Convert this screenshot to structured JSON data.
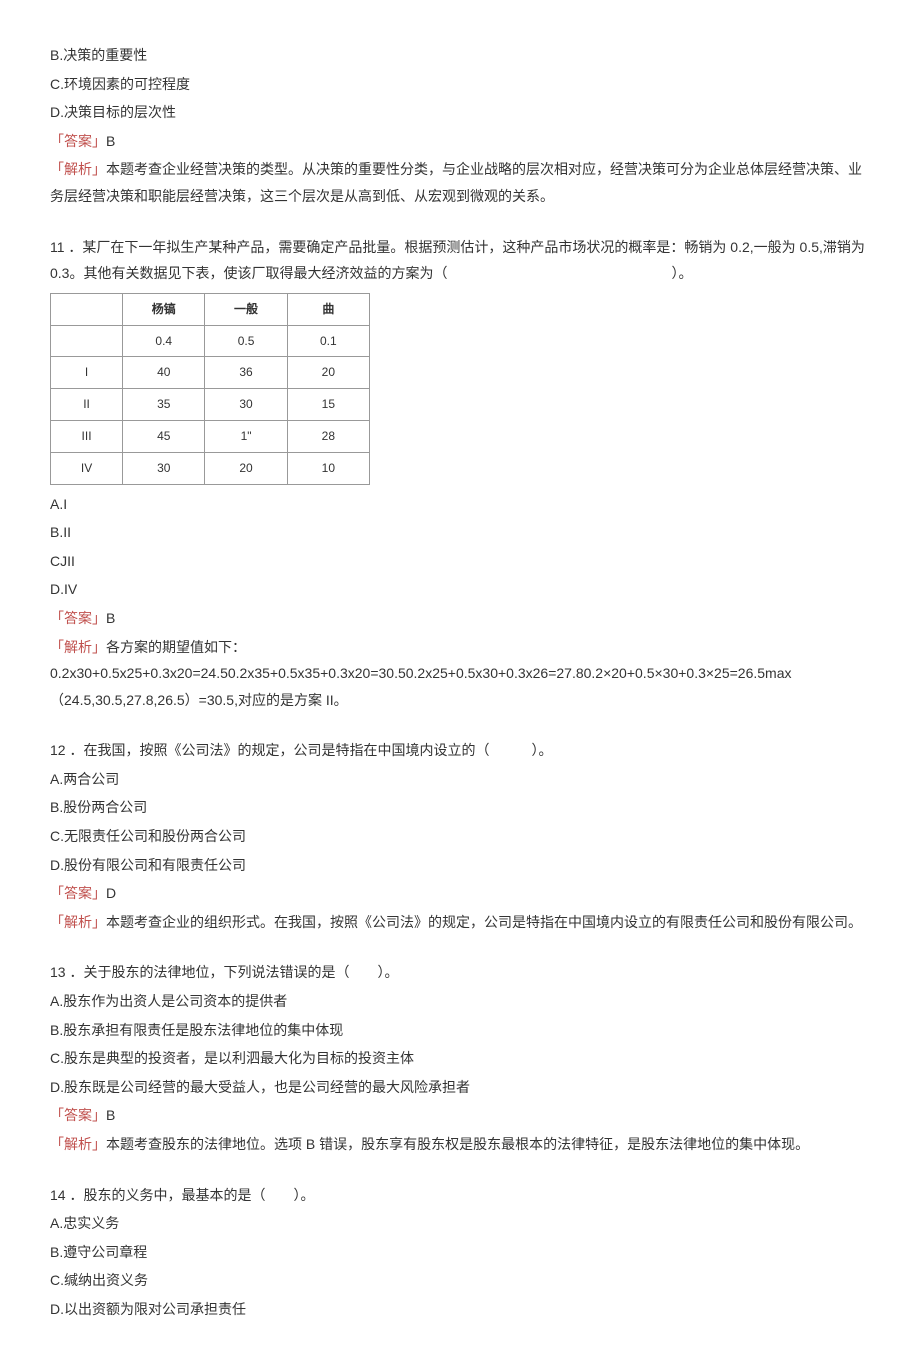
{
  "q10": {
    "optB": "B.决策的重要性",
    "optC": "C.环境因素的可控程度",
    "optD": "D.决策目标的层次性",
    "ansLabel": "「答案」",
    "ansVal": "B",
    "expLabel": "「解析」",
    "expText": "本题考查企业经营决策的类型。从决策的重要性分类，与企业战略的层次相对应，经营决策可分为企业总体层经营决策、业务层经营决策和职能层经营决策，这三个层次是从高到低、从宏观到微观的关系。"
  },
  "q11": {
    "stem": "11 ．某厂在下一年拟生产某种产品，需要确定产品批量。根据预测估计，这种产品市场状况的概率是：畅销为 0.2,一般为 0.5,滞销为 0.3。其他有关数据见下表，使该厂取得最大经济效益的方案为（　　　　　　　　　　　　　　　　）。",
    "table": {
      "h1": "杨镐",
      "h2": "一般",
      "h3": "曲",
      "p1": "0.4",
      "p2": "0.5",
      "p3": "0.1",
      "rows": [
        {
          "name": "I",
          "a": "40",
          "b": "36",
          "c": "20"
        },
        {
          "name": "II",
          "a": "35",
          "b": "30",
          "c": "15"
        },
        {
          "name": "III",
          "a": "45",
          "b": "1\"",
          "c": "28"
        },
        {
          "name": "IV",
          "a": "30",
          "b": "20",
          "c": "10"
        }
      ]
    },
    "optA": "A.I",
    "optB": "B.II",
    "optC": "CJII",
    "optD": "D.IV",
    "ansLabel": "「答案」",
    "ansVal": "B",
    "expLabel": "「解析」",
    "expText": "各方案的期望值如下：0.2x30+0.5x25+0.3x20=24.50.2x35+0.5x35+0.3x20=30.50.2x25+0.5x30+0.3x26=27.80.2×20+0.5×30+0.3×25=26.5max（24.5,30.5,27.8,26.5）=30.5,对应的是方案 II。"
  },
  "q12": {
    "stem": "12 ．在我国，按照《公司法》的规定，公司是特指在中国境内设立的（　　　）。",
    "optA": "A.两合公司",
    "optB": "B.股份两合公司",
    "optC": "C.无限责任公司和股份两合公司",
    "optD": "D.股份有限公司和有限责任公司",
    "ansLabel": "「答案」",
    "ansVal": "D",
    "expLabel": "「解析」",
    "expText": "本题考查企业的组织形式。在我国，按照《公司法》的规定，公司是特指在中国境内设立的有限责任公司和股份有限公司。"
  },
  "q13": {
    "stem": "13 ．关于股东的法律地位，下列说法错误的是（　　）。",
    "optA": "A.股东作为出资人是公司资本的提供者",
    "optB": "B.股东承担有限责任是股东法律地位的集中体现",
    "optC": "C.股东是典型的投资者，是以利泗最大化为目标的投资主体",
    "optD": "D.股东既是公司经营的最大受益人，也是公司经营的最大风险承担者",
    "ansLabel": "「答案」",
    "ansVal": "B",
    "expLabel": "「解析」",
    "expText": "本题考查股东的法律地位。选项 B 错误，股东享有股东权是股东最根本的法律特征，是股东法律地位的集中体现。"
  },
  "q14": {
    "stem": "14 ．股东的义务中，最基本的是（　　）。",
    "optA": "A.忠实义务",
    "optB": "B.遵守公司章程",
    "optC": "C.缄纳出资义务",
    "optD": "D.以出资额为限对公司承担责任"
  }
}
